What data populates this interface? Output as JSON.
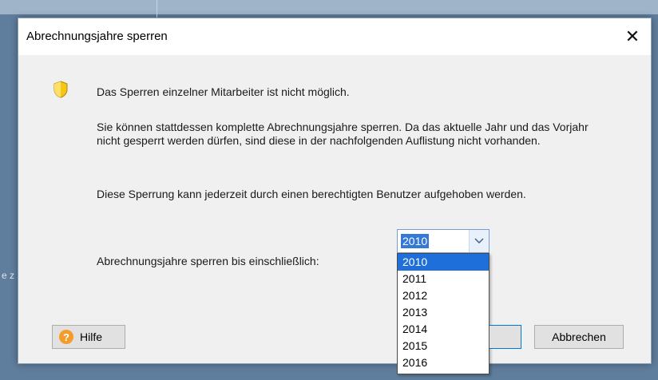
{
  "background": {
    "side_text": "e z"
  },
  "dialog": {
    "title": "Abrechnungsjahre sperren",
    "close_glyph": "✕",
    "icon": "shield-warning-icon",
    "message1": "Das Sperren einzelner Mitarbeiter ist nicht möglich.",
    "message2": "Sie können stattdessen komplette Abrechnungsjahre sperren. Da das aktuelle Jahr und das Vorjahr nicht gesperrt werden dürfen, sind diese in der nachfolgenden Auflistung nicht vorhanden.",
    "message3": "Diese Sperrung kann jederzeit durch einen berechtigten Benutzer aufgehoben werden.",
    "year_label": "Abrechnungsjahre sperren bis einschließlich:",
    "year_select": {
      "value": "2010",
      "options": [
        "2010",
        "2011",
        "2012",
        "2013",
        "2014",
        "2015",
        "2016"
      ],
      "highlighted": "2010"
    },
    "help_button": "Hilfe",
    "help_icon_glyph": "?",
    "cancel_button": "Abbrechen"
  },
  "colors": {
    "selection": "#1e6fd9",
    "help_icon": "#f39c2b",
    "shield": "#f5c518"
  }
}
